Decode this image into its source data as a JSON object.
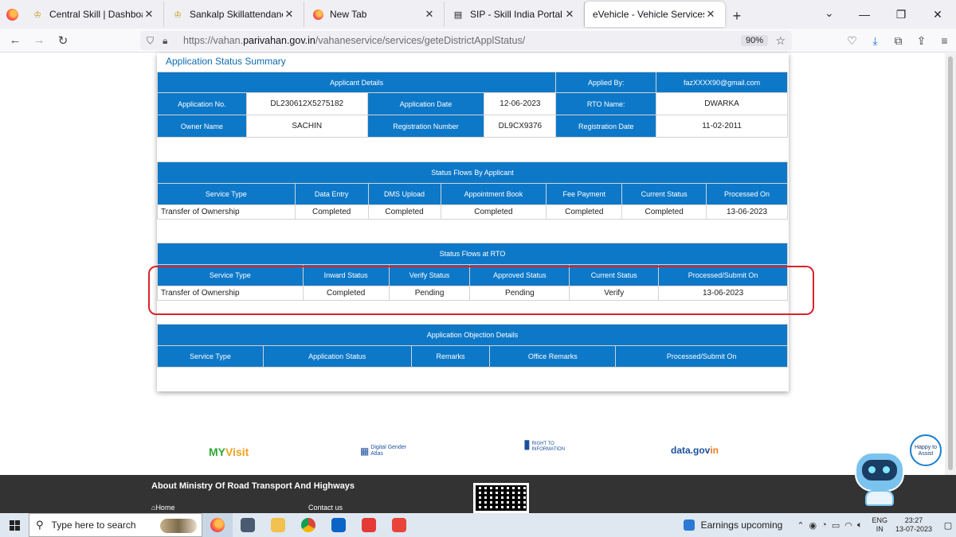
{
  "browser": {
    "tabs": [
      {
        "label": "Central Skill | Dashboard",
        "icon": "emblem-icon"
      },
      {
        "label": "Sankalp Skillattendance | Dashb",
        "icon": "emblem-icon"
      },
      {
        "label": "New Tab",
        "icon": "firefox-icon"
      },
      {
        "label": "SIP - Skill India Portal",
        "icon": "document-icon"
      },
      {
        "label": "eVehicle - Vehicle Services",
        "icon": "none",
        "active": true
      }
    ],
    "url_prefix": "https://vahan.",
    "url_domain": "parivahan.gov.in",
    "url_path": "/vahaneservice/services/geteDistrictApplStatus/",
    "zoom": "90%"
  },
  "page": {
    "title": "Application Status Summary",
    "applicant": {
      "section_label": "Applicant Details",
      "applied_by_label": "Applied By:",
      "applied_by_value": "fazXXXX90@gmail.com",
      "app_no_label": "Application No.",
      "app_no_value": "DL230612X5275182",
      "app_date_label": "Application Date",
      "app_date_value": "12-06-2023",
      "rto_label": "RTO Name:",
      "rto_value": "DWARKA",
      "owner_label": "Owner Name",
      "owner_value": "SACHIN",
      "reg_no_label": "Registration Number",
      "reg_no_value": "DL9CX9376",
      "reg_date_label": "Registration Date",
      "reg_date_value": "11-02-2011"
    },
    "applicant_flow": {
      "section_label": "Status Flows By Applicant",
      "headers": [
        "Service Type",
        "Data Entry",
        "DMS Upload",
        "Appointment Book",
        "Fee Payment",
        "Current Status",
        "Processed On"
      ],
      "row": [
        "Transfer of Ownership",
        "Completed",
        "Completed",
        "Completed",
        "Completed",
        "Completed",
        "13-06-2023"
      ]
    },
    "rto_flow": {
      "section_label": "Status Flows at RTO",
      "headers": [
        "Service Type",
        "Inward Status",
        "Verify Status",
        "Approved Status",
        "Current Status",
        "Processed/Submit On"
      ],
      "row": [
        "Transfer of Ownership",
        "Completed",
        "Pending",
        "Pending",
        "Verify",
        "13-06-2023"
      ]
    },
    "objection": {
      "section_label": "Application Objection Details",
      "headers": [
        "Service Type",
        "Application Status",
        "Remarks",
        "Office Remarks",
        "Processed/Submit On"
      ]
    }
  },
  "logos": {
    "myvisit_a": "MY",
    "myvisit_b": "Visit",
    "dga": "Digital Gender Atlas",
    "rti": "RIGHT TO INFORMATION",
    "datagov_a": "data.gov",
    "datagov_b": "in"
  },
  "footer": {
    "title": "About Ministry Of Road Transport And Highways",
    "home": "Home",
    "contact": "Contact us"
  },
  "assistant": {
    "bubble": "Happy to Assist"
  },
  "taskbar": {
    "search_placeholder": "Type here to search",
    "weather": "Earnings upcoming",
    "lang_a": "ENG",
    "lang_b": "IN",
    "time": "23:27",
    "date": "13-07-2023"
  }
}
